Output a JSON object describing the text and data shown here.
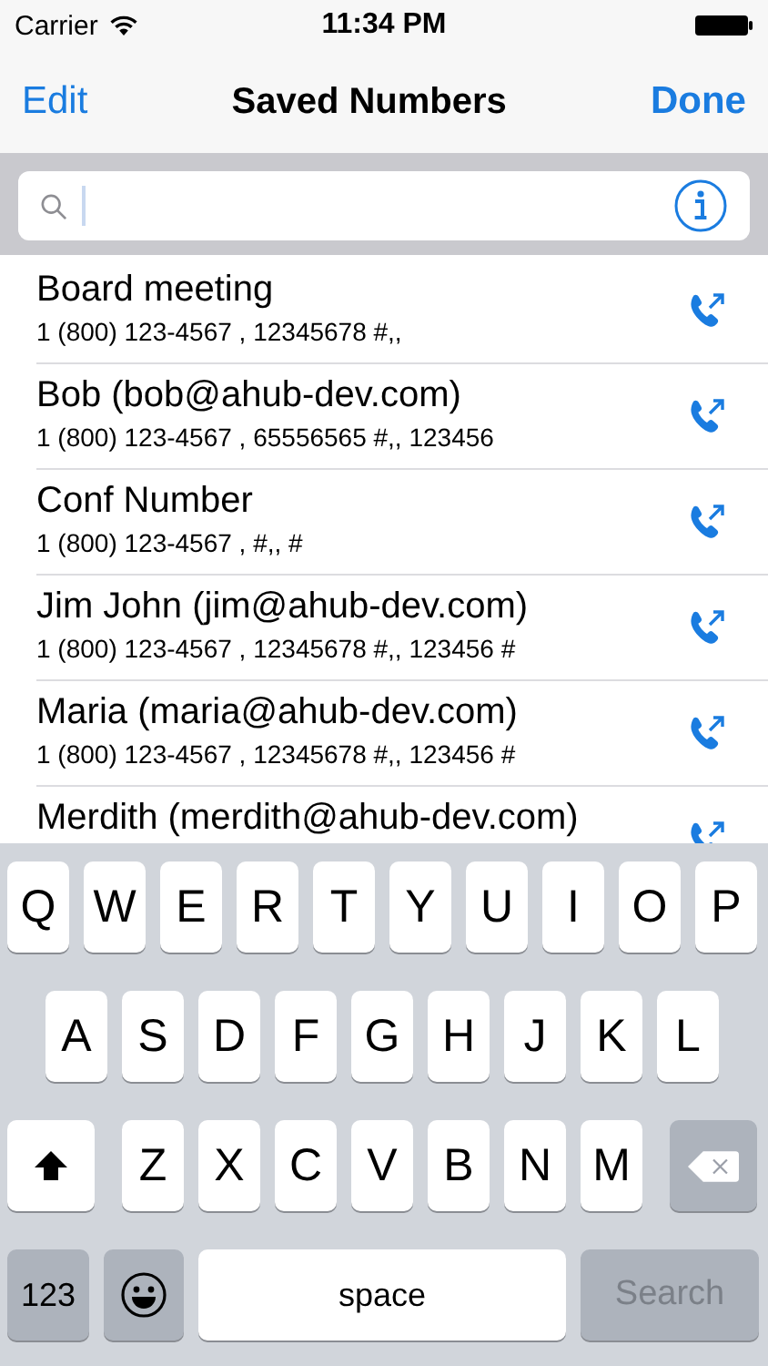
{
  "status_bar": {
    "carrier": "Carrier",
    "time": "11:34 PM"
  },
  "nav_bar": {
    "left_button": "Edit",
    "title": "Saved Numbers",
    "right_button": "Done"
  },
  "rows": [
    {
      "name": "Board meeting",
      "number": "1 (800) 123-4567 , 12345678 #,,"
    },
    {
      "name": "Bob (bob@ahub-dev.com)",
      "number": "1 (800) 123-4567 , 65556565 #,, 123456"
    },
    {
      "name": "Conf Number",
      "number": "1 (800) 123-4567 ,  #,,  #"
    },
    {
      "name": "Jim John (jim@ahub-dev.com)",
      "number": "1 (800) 123-4567 , 12345678 #,, 123456 #"
    },
    {
      "name": "Maria (maria@ahub-dev.com)",
      "number": "1 (800) 123-4567 , 12345678 #,, 123456 #"
    },
    {
      "name": "Merdith (merdith@ahub-dev.com)"
    }
  ],
  "keyboard": {
    "rows": [
      {
        "keys": [
          {
            "kind": "letter",
            "label": "Q"
          },
          {
            "kind": "letter",
            "label": "W"
          },
          {
            "kind": "letter",
            "label": "E"
          },
          {
            "kind": "letter",
            "label": "R"
          },
          {
            "kind": "letter",
            "label": "T"
          },
          {
            "kind": "letter",
            "label": "Y"
          },
          {
            "kind": "letter",
            "label": "U"
          },
          {
            "kind": "letter",
            "label": "I"
          },
          {
            "kind": "letter",
            "label": "O"
          },
          {
            "kind": "letter",
            "label": "P"
          }
        ]
      },
      {
        "keys": [
          {
            "kind": "letter",
            "label": "A"
          },
          {
            "kind": "letter",
            "label": "S"
          },
          {
            "kind": "letter",
            "label": "D"
          },
          {
            "kind": "letter",
            "label": "F"
          },
          {
            "kind": "letter",
            "label": "G"
          },
          {
            "kind": "letter",
            "label": "H"
          },
          {
            "kind": "letter",
            "label": "J"
          },
          {
            "kind": "letter",
            "label": "K"
          },
          {
            "kind": "letter",
            "label": "L"
          }
        ]
      },
      {
        "keys": [
          {
            "kind": "shift"
          },
          {
            "kind": "letter",
            "label": "Z"
          },
          {
            "kind": "letter",
            "label": "X"
          },
          {
            "kind": "letter",
            "label": "C"
          },
          {
            "kind": "letter",
            "label": "V"
          },
          {
            "kind": "letter",
            "label": "B"
          },
          {
            "kind": "letter",
            "label": "N"
          },
          {
            "kind": "letter",
            "label": "M"
          },
          {
            "kind": "delete"
          }
        ]
      },
      {
        "keys": [
          {
            "kind": "mode",
            "label": "123"
          },
          {
            "kind": "emoji"
          },
          {
            "kind": "space",
            "label": "space"
          },
          {
            "kind": "action",
            "label": "Search",
            "disabled": true
          }
        ]
      }
    ]
  }
}
